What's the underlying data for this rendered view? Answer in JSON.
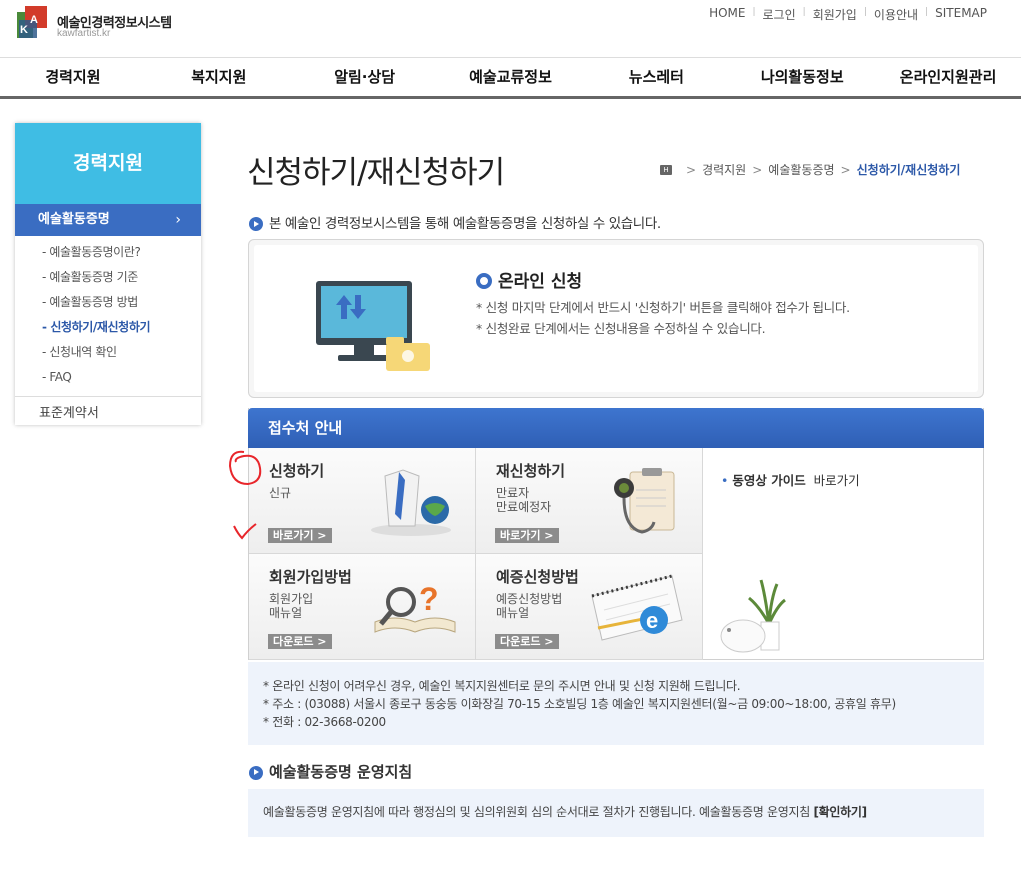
{
  "header": {
    "logo_text": "예술인경력정보시스템",
    "logo_sub": "kawfartist.kr",
    "top_links": [
      "HOME",
      "로그인",
      "회원가입",
      "이용안내",
      "SITEMAP"
    ]
  },
  "gnb": [
    "경력지원",
    "복지지원",
    "알림·상담",
    "예술교류정보",
    "뉴스레터",
    "나의활동정보",
    "온라인지원관리"
  ],
  "sidebar": {
    "title": "경력지원",
    "active": "예술활동증명",
    "subs": [
      "- 예술활동증명이란?",
      "- 예술활동증명 기준",
      "- 예술활동증명 방법",
      "- 신청하기/재신청하기",
      "- 신청내역 확인",
      "- FAQ"
    ],
    "active_sub_index": 3,
    "bottom": "표준계약서"
  },
  "page": {
    "title": "신청하기/재신청하기",
    "breadcrumb": [
      "경력지원",
      "예술활동증명",
      "신청하기/재신청하기"
    ],
    "intro": "본 예술인 경력정보시스템을 통해 예술활동증명을 신청하실 수 있습니다."
  },
  "online": {
    "title": "온라인 신청",
    "notes": [
      "* 신청 마지막 단계에서 반드시 '신청하기' 버튼을 클릭해야 접수가 됩니다.",
      "* 신청완료 단계에서는 신청내용을 수정하실 수 있습니다."
    ]
  },
  "reception": {
    "title": "접수처 안내",
    "cells": [
      {
        "title": "신청하기",
        "desc": [
          "신규"
        ],
        "button": "바로가기 >"
      },
      {
        "title": "재신청하기",
        "desc": [
          "만료자",
          "만료예정자"
        ],
        "button": "바로가기 >"
      },
      {
        "title": "회원가입방법",
        "desc": [
          "회원가입",
          "매뉴얼"
        ],
        "button": "다운로드 >"
      },
      {
        "title": "예증신청방법",
        "desc": [
          "예증신청방법",
          "매뉴얼"
        ],
        "button": "다운로드 >"
      }
    ],
    "guide_bullet": "•",
    "guide_label": "동영상 가이드",
    "guide_link": "바로가기"
  },
  "notice": [
    "* 온라인 신청이 어려우신 경우, 예술인 복지지원센터로 문의 주시면 안내 및 신청 지원해 드립니다.",
    "* 주소 : (03088) 서울시 종로구 동숭동 이화장길 70-15 소호빌딩 1층 예술인 복지지원센터(월~금 09:00~18:00, 공휴일 휴무)",
    "* 전화 : 02-3668-0200"
  ],
  "rules": {
    "title": "예술활동증명 운영지침",
    "text": "예술활동증명 운영지침에 따라 행정심의 및 심의위원회 심의 순서대로 절차가 진행됩니다. 예술활동증명 운영지침",
    "link": "[확인하기]"
  },
  "colors": {
    "accent": "#3a6dc2",
    "side_head": "#3fbde4",
    "annotation": "#e8262b"
  }
}
